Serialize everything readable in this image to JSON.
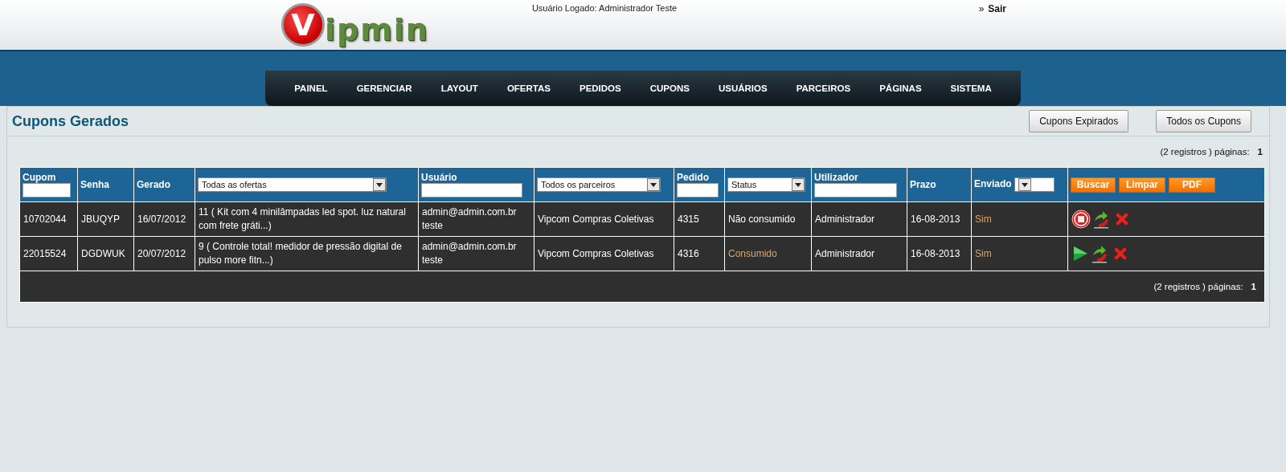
{
  "header": {
    "logo": {
      "letter": "V",
      "rest": "ipmin"
    },
    "user": "Usuário Logado: Administrador Teste",
    "logout": {
      "marker": "»",
      "label": "Sair"
    }
  },
  "nav": [
    "PAINEL",
    "GERENCIAR",
    "LAYOUT",
    "OFERTAS",
    "PEDIDOS",
    "CUPONS",
    "USUÁRIOS",
    "PARCEIROS",
    "PÁGINAS",
    "SISTEMA"
  ],
  "page": {
    "title": "Cupons Gerados",
    "buttons": [
      "Cupons Expirados",
      "Todos os Cupons"
    ],
    "pagination": {
      "records": "(2 registros ) páginas:",
      "page": "1"
    }
  },
  "table": {
    "columns": [
      {
        "kind": "input",
        "label": "Cupom"
      },
      {
        "kind": "label",
        "label": "Senha"
      },
      {
        "kind": "label",
        "label": "Gerado"
      },
      {
        "kind": "select",
        "value": "Todas as ofertas"
      },
      {
        "kind": "input",
        "label": "Usuário"
      },
      {
        "kind": "select",
        "value": "Todos os parceiros"
      },
      {
        "kind": "input",
        "label": "Pedido"
      },
      {
        "kind": "select",
        "value": "Status"
      },
      {
        "kind": "input",
        "label": "Utilizador"
      },
      {
        "kind": "label",
        "label": "Prazo"
      },
      {
        "kind": "label_select",
        "label": "Enviado"
      }
    ],
    "actions": [
      "Buscar",
      "Limpar",
      "PDF"
    ],
    "rows": [
      {
        "cupom": "10702044",
        "senha": "JBUQYP",
        "gerado": "16/07/2012",
        "oferta": "11  ( Kit com 4 minilâmpadas led spot. luz natural com frete gráti...)",
        "usuario": "admin@admin.com.br teste",
        "parceiro": "Vipcom Compras Coletivas",
        "pedido": "4315",
        "status": "Não consumido",
        "consumed": false,
        "utilizador": "Administrador",
        "prazo": "16-08-2013",
        "enviado": "Sim"
      },
      {
        "cupom": "22015524",
        "senha": "DGDWUK",
        "gerado": "20/07/2012",
        "oferta": "9  ( Controle total! medidor de pressão digital de pulso more fitn...)",
        "usuario": "admin@admin.com.br teste",
        "parceiro": "Vipcom Compras Coletivas",
        "pedido": "4316",
        "status": "Consumido",
        "consumed": true,
        "utilizador": "Administrador",
        "prazo": "16-08-2013",
        "enviado": "Sim"
      }
    ],
    "footer": {
      "records": "(2 registros ) páginas:",
      "page": "1"
    }
  }
}
